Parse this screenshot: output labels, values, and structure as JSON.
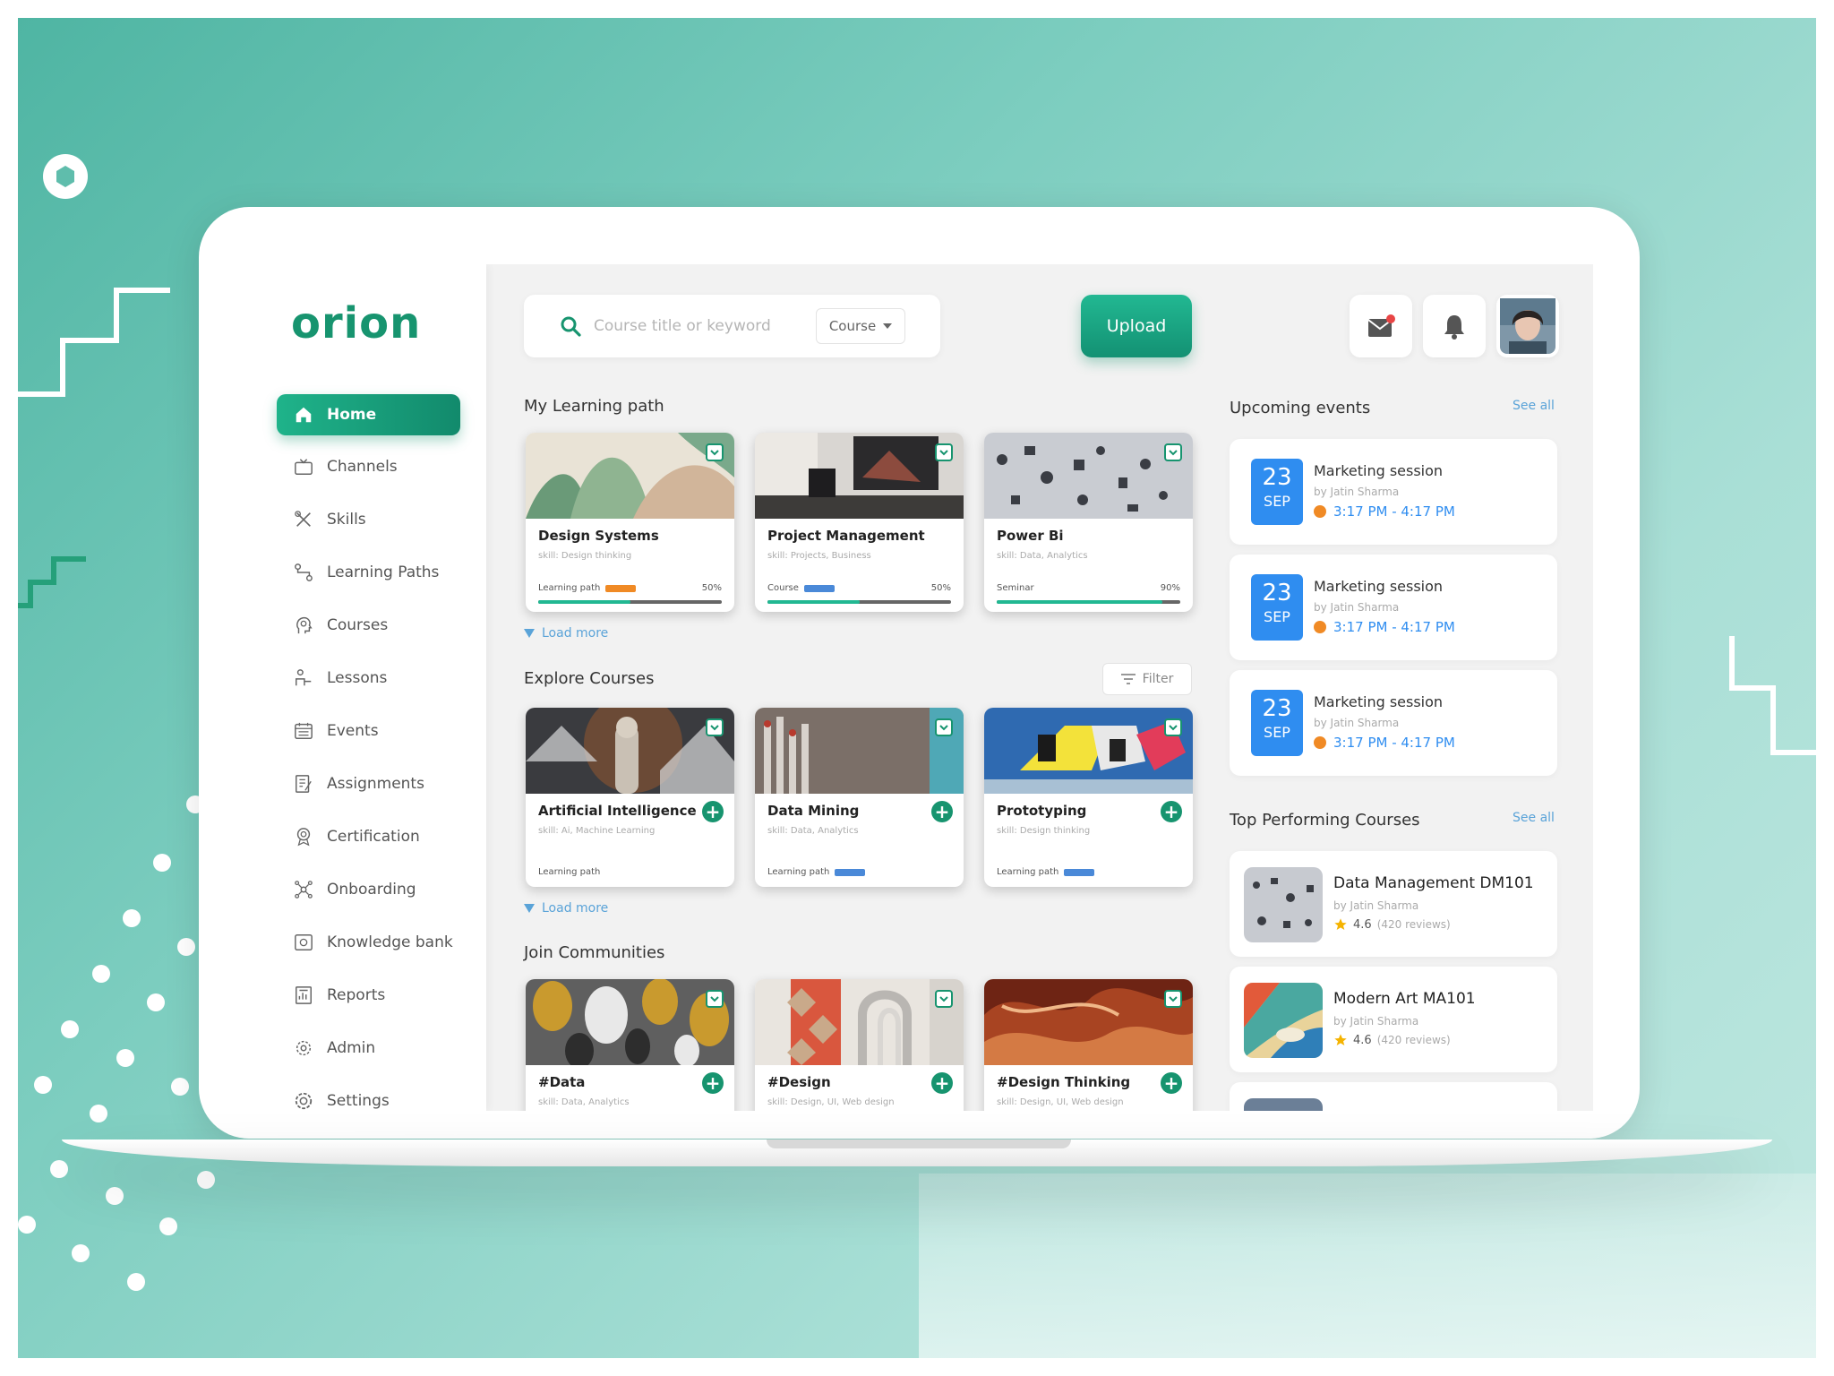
{
  "brand": {
    "name": "orion"
  },
  "nav": [
    {
      "label": "Home",
      "icon": "home-icon",
      "active": true
    },
    {
      "label": "Channels",
      "icon": "tv-icon"
    },
    {
      "label": "Skills",
      "icon": "tools-icon"
    },
    {
      "label": "Learning Paths",
      "icon": "path-icon"
    },
    {
      "label": "Courses",
      "icon": "head-gear-icon"
    },
    {
      "label": "Lessons",
      "icon": "lessons-icon"
    },
    {
      "label": "Events",
      "icon": "calendar-icon"
    },
    {
      "label": "Assignments",
      "icon": "assignment-icon"
    },
    {
      "label": "Certification",
      "icon": "badge-icon"
    },
    {
      "label": "Onboarding",
      "icon": "network-icon"
    },
    {
      "label": "Knowledge bank",
      "icon": "safe-icon"
    },
    {
      "label": "Reports",
      "icon": "report-icon"
    },
    {
      "label": "Admin",
      "icon": "admin-icon"
    },
    {
      "label": "Settings",
      "icon": "gear-icon"
    }
  ],
  "search": {
    "placeholder": "Course title or keyword",
    "dropdown": "Course"
  },
  "upload_label": "Upload",
  "sections": {
    "learning": "My Learning path",
    "explore": "Explore Courses",
    "communities": "Join Communities",
    "events": "Upcoming events",
    "top": "Top Performing Courses"
  },
  "load_more": "Load more",
  "filter_label": "Filter",
  "see_all": "See all",
  "learning": [
    {
      "title": "Design Systems",
      "skill": "skill: Design thinking",
      "type": "Learning path",
      "tag_color": "#f08a25",
      "pct": "50%",
      "progress": 0.5
    },
    {
      "title": "Project Management",
      "skill": "skill: Projects, Business",
      "type": "Course",
      "tag_color": "#4a89d8",
      "pct": "50%",
      "progress": 0.5
    },
    {
      "title": "Power Bi",
      "skill": "skill: Data, Analytics",
      "type": "Seminar",
      "tag_color": "",
      "pct": "90%",
      "progress": 0.9
    }
  ],
  "explore": [
    {
      "title": "Artificial Intelligence",
      "skill": "skill: Ai, Machine Learning",
      "type": "Learning path",
      "tag_color": ""
    },
    {
      "title": "Data Mining",
      "skill": "skill: Data, Analytics",
      "type": "Learning path",
      "tag_color": "#4a89d8"
    },
    {
      "title": "Prototyping",
      "skill": "skill: Design thinking",
      "type": "Learning path",
      "tag_color": "#4a89d8"
    }
  ],
  "communities": [
    {
      "title": "#Data",
      "skill": "skill: Data, Analytics"
    },
    {
      "title": "#Design",
      "skill": "skill: Design, UI, Web design"
    },
    {
      "title": "#Design Thinking",
      "skill": "skill: Design, UI, Web design"
    }
  ],
  "events": [
    {
      "day": "23",
      "month": "SEP",
      "title": "Marketing session",
      "by": "by Jatin Sharma",
      "time": "3:17 PM - 4:17 PM"
    },
    {
      "day": "23",
      "month": "SEP",
      "title": "Marketing session",
      "by": "by Jatin Sharma",
      "time": "3:17 PM - 4:17 PM"
    },
    {
      "day": "23",
      "month": "SEP",
      "title": "Marketing session",
      "by": "by Jatin Sharma",
      "time": "3:17 PM - 4:17 PM"
    }
  ],
  "top_courses": [
    {
      "title": "Data Management DM101",
      "by": "by Jatin Sharma",
      "rating": "4.6",
      "reviews": "(420 reviews)"
    },
    {
      "title": "Modern Art MA101",
      "by": "by Jatin Sharma",
      "rating": "4.6",
      "reviews": "(420 reviews)"
    }
  ],
  "colors": {
    "accent": "#17946f",
    "link": "#5aa3d8",
    "event": "#2f8df0",
    "warn": "#f08a25",
    "notify": "#e84545"
  }
}
